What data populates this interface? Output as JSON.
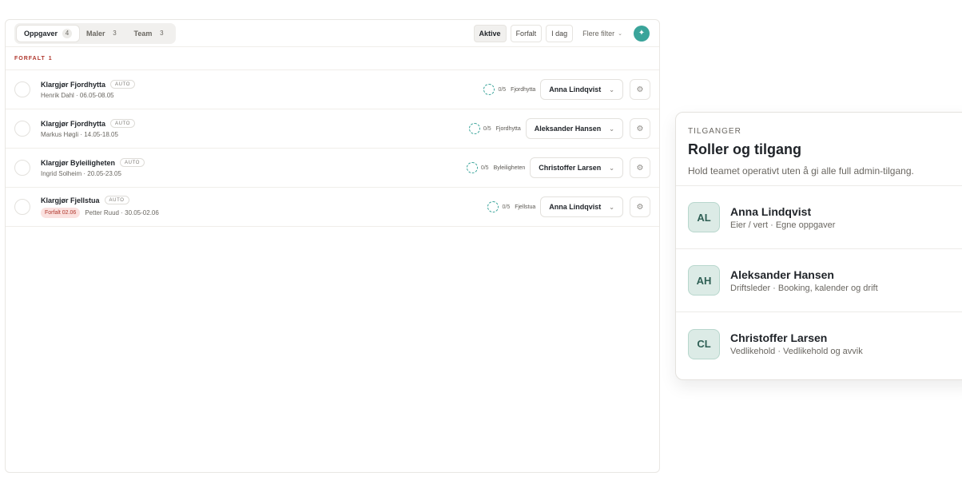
{
  "tabs": [
    {
      "label": "Oppgaver",
      "count": "4"
    },
    {
      "label": "Maler",
      "count": "3"
    },
    {
      "label": "Team",
      "count": "3"
    }
  ],
  "filters": {
    "active": "Aktive",
    "overdue": "Forfalt",
    "today": "I dag",
    "more": "Flere filter",
    "spark_icon": "✦"
  },
  "section": {
    "label": "FORFALT",
    "count": "1"
  },
  "tasks": [
    {
      "title": "Klargjør Fjordhytta",
      "tag": "AUTO",
      "overdue": "",
      "meta": "Henrik Dahl · 06.05-08.05",
      "progress": "0/5",
      "location": "Fjordhytta",
      "assignee": "Anna Lindqvist"
    },
    {
      "title": "Klargjør Fjordhytta",
      "tag": "AUTO",
      "overdue": "",
      "meta": "Markus Høgli · 14.05-18.05",
      "progress": "0/5",
      "location": "Fjordhytta",
      "assignee": "Aleksander Hansen"
    },
    {
      "title": "Klargjør Byleiligheten",
      "tag": "AUTO",
      "overdue": "",
      "meta": "Ingrid Solheim · 20.05-23.05",
      "progress": "0/5",
      "location": "Byleiligheten",
      "assignee": "Christoffer Larsen"
    },
    {
      "title": "Klargjør Fjellstua",
      "tag": "AUTO",
      "overdue": "Forfalt 02.06",
      "meta": "Petter Ruud · 30.05-02.06",
      "progress": "0/5",
      "location": "Fjellstua",
      "assignee": "Anna Lindqvist"
    }
  ],
  "roles": {
    "eyebrow": "TILGANGER",
    "title": "Roller og tilgang",
    "subtitle": "Hold teamet operativt uten å gi alle full admin-tilgang.",
    "members": [
      {
        "initials": "AL",
        "name": "Anna Lindqvist",
        "role": "Eier / vert · Egne oppgaver"
      },
      {
        "initials": "AH",
        "name": "Aleksander Hansen",
        "role": "Driftsleder · Booking, kalender og drift"
      },
      {
        "initials": "CL",
        "name": "Christoffer Larsen",
        "role": "Vedlikehold · Vedlikehold og avvik"
      }
    ]
  },
  "colors": {
    "accent": "#3aa49a",
    "danger": "#b0372d",
    "avatar_bg": "#dcebe6"
  }
}
